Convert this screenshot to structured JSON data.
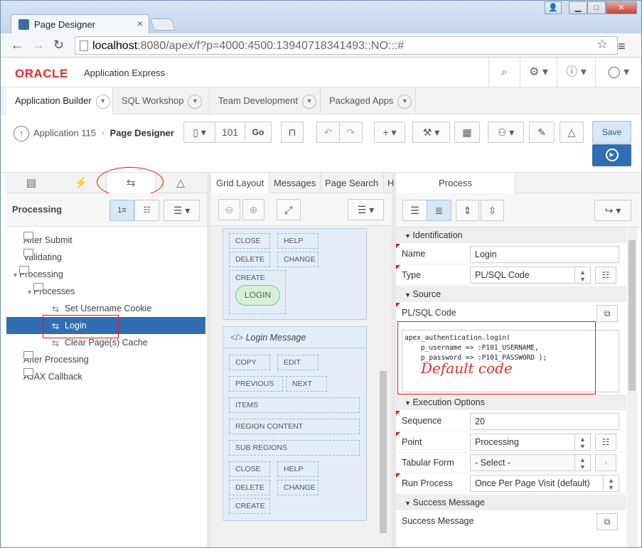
{
  "browser": {
    "tab_title": "Page Designer",
    "tab_close": "×",
    "url_host": "localhost",
    "url_rest": ":8080/apex/f?p=4000:4500:13940718341493::NO:::#"
  },
  "header": {
    "logo": "ORACLE",
    "product": "Application Express"
  },
  "app_tabs": [
    {
      "label": "Application Builder"
    },
    {
      "label": "SQL Workshop"
    },
    {
      "label": "Team Development"
    },
    {
      "label": "Packaged Apps"
    }
  ],
  "toolbar": {
    "breadcrumb_app": "Application 115",
    "breadcrumb_page": "Page Designer",
    "page_number": "101",
    "go_label": "Go",
    "save_label": "Save"
  },
  "left": {
    "heading": "Processing",
    "tree": [
      {
        "label": "After Submit",
        "level": 1,
        "kind": "folder"
      },
      {
        "label": "Validating",
        "level": 1,
        "kind": "folder"
      },
      {
        "label": "Processing",
        "level": 1,
        "kind": "folder",
        "expanded": true
      },
      {
        "label": "Processes",
        "level": 2,
        "kind": "folder",
        "expanded": true
      },
      {
        "label": "Set Username Cookie",
        "level": 3,
        "kind": "process"
      },
      {
        "label": "Login",
        "level": 3,
        "kind": "process",
        "selected": true
      },
      {
        "label": "Clear Page(s) Cache",
        "level": 3,
        "kind": "process"
      },
      {
        "label": "After Processing",
        "level": 1,
        "kind": "folder"
      },
      {
        "label": "AJAX Callback",
        "level": 1,
        "kind": "folder"
      }
    ]
  },
  "middle": {
    "tabs": [
      "Grid Layout",
      "Messages",
      "Page Search",
      "H"
    ],
    "card1_slots": [
      "CLOSE",
      "HELP",
      "DELETE",
      "CHANGE",
      "CREATE"
    ],
    "card1_button": "LOGIN",
    "card2_title": "Login Message",
    "card2_slots": [
      "COPY",
      "EDIT",
      "PREVIOUS",
      "NEXT",
      "ITEMS",
      "REGION CONTENT",
      "SUB REGIONS",
      "CLOSE",
      "HELP",
      "DELETE",
      "CHANGE",
      "CREATE"
    ]
  },
  "right": {
    "tab": "Process",
    "sections": {
      "identification": "Identification",
      "source": "Source",
      "execution": "Execution Options",
      "success": "Success Message"
    },
    "name_label": "Name",
    "name_value": "Login",
    "type_label": "Type",
    "type_value": "PL/SQL Code",
    "plsql_label": "PL/SQL Code",
    "plsql_code": "apex_authentication.login(\n    p_username => :P101_USERNAME,\n    p_password => :P101_PASSWORD );",
    "annotation": "Default code",
    "sequence_label": "Sequence",
    "sequence_value": "20",
    "point_label": "Point",
    "point_value": "Processing",
    "tabular_label": "Tabular Form",
    "tabular_value": "- Select -",
    "run_label": "Run Process",
    "run_value": "Once Per Page Visit (default)",
    "success_label": "Success Message"
  },
  "colors": {
    "brand_red": "#e12c2c",
    "selected_blue": "#2f6eb4",
    "annotation_red": "#e11111"
  }
}
